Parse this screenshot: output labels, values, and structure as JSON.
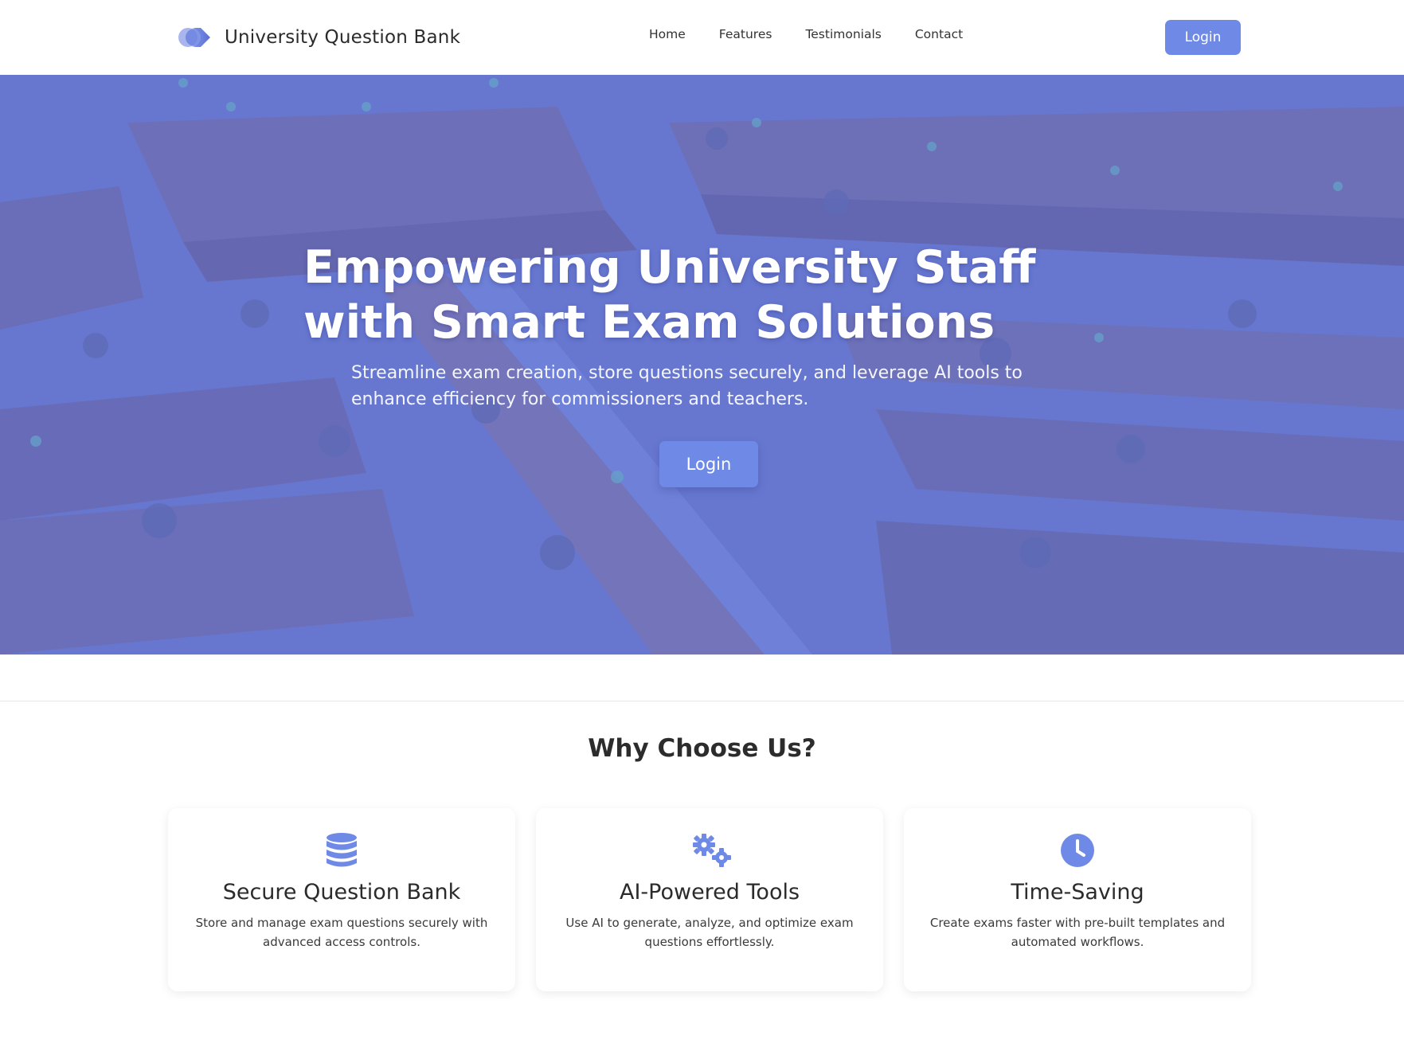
{
  "brand": {
    "title": "University Question Bank",
    "logo_icon": "overlapping-circles-logo"
  },
  "nav": {
    "items": [
      "Home",
      "Features",
      "Testimonials",
      "Contact"
    ]
  },
  "header": {
    "login_label": "Login"
  },
  "hero": {
    "title": "Empowering University Staff with Smart Exam Solutions",
    "subtitle": "Streamline exam creation, store questions securely, and leverage AI tools to enhance efficiency for commissioners and teachers.",
    "login_label": "Login"
  },
  "features": {
    "heading": "Why Choose Us?",
    "cards": [
      {
        "icon": "database-icon",
        "title": "Secure Question Bank",
        "description": "Store and manage exam questions securely with advanced access controls."
      },
      {
        "icon": "gears-icon",
        "title": "AI-Powered Tools",
        "description": "Use AI to generate, analyze, and optimize exam questions effortlessly."
      },
      {
        "icon": "clock-icon",
        "title": "Time-Saving",
        "description": "Create exams faster with pre-built templates and automated workflows."
      }
    ]
  },
  "colors": {
    "accent": "#6f8ae6",
    "hero_overlay": "#7082de",
    "text": "#2d2d2d"
  }
}
